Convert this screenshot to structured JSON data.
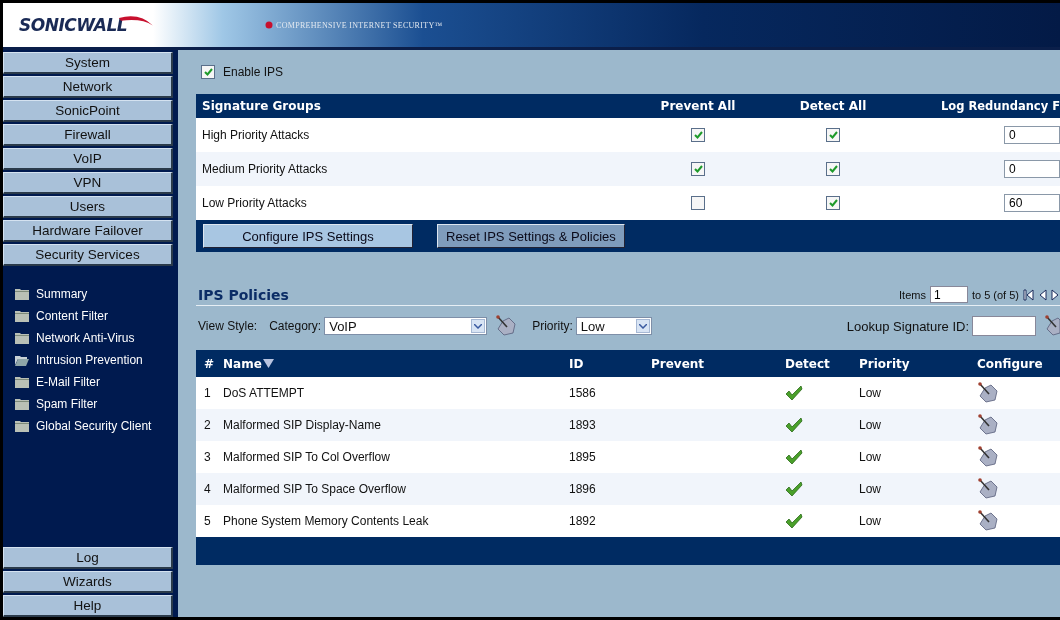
{
  "header": {
    "logo": "SONICWALL",
    "tagline": "COMPREHENSIVE INTERNET SECURITY™"
  },
  "sidebar": {
    "sections": [
      {
        "label": "System"
      },
      {
        "label": "Network"
      },
      {
        "label": "SonicPoint"
      },
      {
        "label": "Firewall"
      },
      {
        "label": "VoIP"
      },
      {
        "label": "VPN"
      },
      {
        "label": "Users"
      },
      {
        "label": "Hardware Failover"
      },
      {
        "label": "Security Services"
      }
    ],
    "submenu": [
      {
        "label": "Summary",
        "selected": false
      },
      {
        "label": "Content Filter",
        "selected": false
      },
      {
        "label": "Network Anti-Virus",
        "selected": false
      },
      {
        "label": "Intrusion Prevention",
        "selected": true
      },
      {
        "label": "E-Mail Filter",
        "selected": false
      },
      {
        "label": "Spam Filter",
        "selected": false
      },
      {
        "label": "Global Security Client",
        "selected": false
      }
    ],
    "bottom_sections": [
      {
        "label": "Log"
      },
      {
        "label": "Wizards"
      },
      {
        "label": "Help"
      }
    ]
  },
  "enable_ips": {
    "label": "Enable IPS",
    "checked": true
  },
  "signature_groups": {
    "columns": [
      "Signature Groups",
      "Prevent All",
      "Detect All",
      "Log Redundancy F"
    ],
    "rows": [
      {
        "name": "High Priority Attacks",
        "prevent_all": true,
        "detect_all": true,
        "log_redundancy": "0"
      },
      {
        "name": "Medium Priority Attacks",
        "prevent_all": true,
        "detect_all": true,
        "log_redundancy": "0"
      },
      {
        "name": "Low Priority Attacks",
        "prevent_all": false,
        "detect_all": true,
        "log_redundancy": "60"
      }
    ],
    "buttons": [
      "Configure IPS Settings",
      "Reset IPS Settings & Policies"
    ]
  },
  "ips_policies": {
    "title": "IPS Policies",
    "items_label": "Items",
    "items_value": "1",
    "range": "to 5 (of 5)",
    "view_style": "View Style:",
    "category_label": "Category:",
    "category": "VoIP",
    "priority_label": "Priority:",
    "priority": "Low",
    "lookup_label": "Lookup Signature ID:",
    "columns": [
      "#",
      "Name",
      "ID",
      "Prevent",
      "Detect",
      "Priority",
      "Configure"
    ],
    "rows": [
      {
        "num": "1",
        "name": "DoS ATTEMPT",
        "id": "1586",
        "detect": true,
        "priority": "Low"
      },
      {
        "num": "2",
        "name": "Malformed SIP Display-Name",
        "id": "1893",
        "detect": true,
        "priority": "Low"
      },
      {
        "num": "3",
        "name": "Malformed SIP To Col Overflow",
        "id": "1895",
        "detect": true,
        "priority": "Low"
      },
      {
        "num": "4",
        "name": "Malformed SIP To Space Overflow",
        "id": "1896",
        "detect": true,
        "priority": "Low"
      },
      {
        "num": "5",
        "name": "Phone System Memory Contents Leak",
        "id": "1892",
        "detect": true,
        "priority": "Low"
      }
    ]
  }
}
